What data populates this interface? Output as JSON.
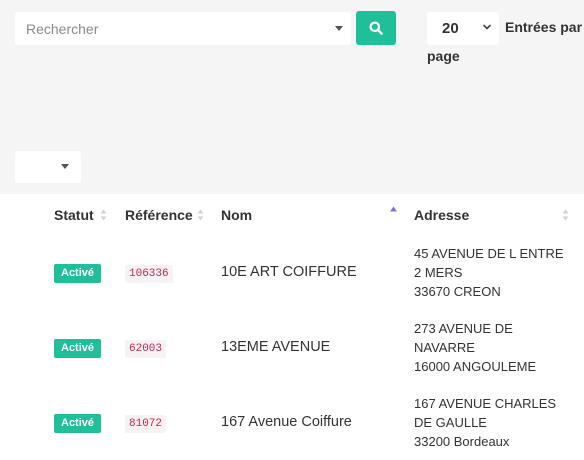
{
  "search": {
    "placeholder": "Rechercher",
    "value": ""
  },
  "pagination": {
    "per_page_value": "20",
    "per_page_label_line1": "Entrées par",
    "per_page_label_line2": "page"
  },
  "table": {
    "headers": {
      "statut": "Statut",
      "reference": "Référence",
      "nom": "Nom",
      "adresse": "Adresse"
    },
    "sorted_column": "nom",
    "rows": [
      {
        "statut": "Activé",
        "reference": "106336",
        "nom": "10E ART COIFFURE",
        "adresse": [
          "45 AVENUE DE L ENTRE",
          "2 MERS",
          "33670 CREON"
        ]
      },
      {
        "statut": "Activé",
        "reference": "62003",
        "nom": "13EME AVENUE",
        "adresse": [
          "273 AVENUE DE",
          "NAVARRE",
          "16000 ANGOULEME"
        ]
      },
      {
        "statut": "Activé",
        "reference": "81072",
        "nom": "167 Avenue Coiffure",
        "adresse": [
          "167 AVENUE CHARLES",
          "DE GAULLE",
          "33200 Bordeaux"
        ]
      }
    ]
  },
  "colors": {
    "accent": "#1fbf9a",
    "code_text": "#c7254e",
    "sort_active": "#7b74d6",
    "background": "#f5f5f6"
  },
  "icons": {
    "search_button": "search-icon",
    "dropdown": "caret-down-icon",
    "sort": "sort-icon"
  }
}
